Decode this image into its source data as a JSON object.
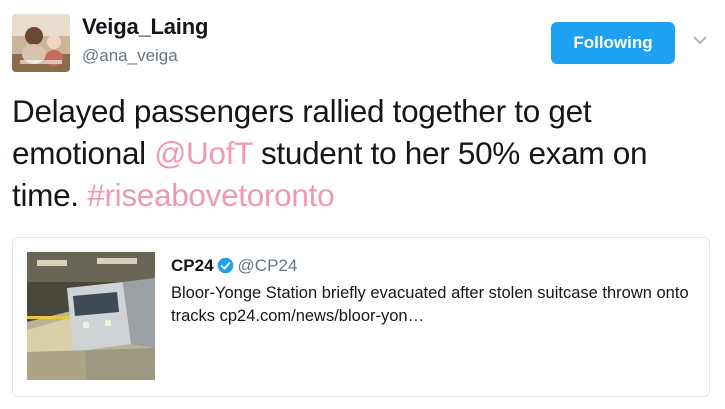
{
  "user": {
    "display_name": "Veiga_Laing",
    "handle": "@ana_veiga",
    "avatar_icon": "profile-photo"
  },
  "follow_button": {
    "label": "Following",
    "color": "#1da1f2"
  },
  "menu_icon": "chevron-down-icon",
  "tweet": {
    "text_part1": "Delayed passengers rallied together to get emotional ",
    "mention": "@UofT",
    "text_part2": " student to her 50% exam on time. ",
    "hashtag": "#riseabovetoronto",
    "link_color": "#f09ab2"
  },
  "quoted_tweet": {
    "author_name": "CP24",
    "verified_icon": "verified-badge-icon",
    "author_handle": "@CP24",
    "text": "Bloor-Yonge Station briefly evacuated after stolen suitcase thrown onto tracks cp24.com/news/bloor-yon…",
    "thumbnail_icon": "subway-train-photo"
  }
}
